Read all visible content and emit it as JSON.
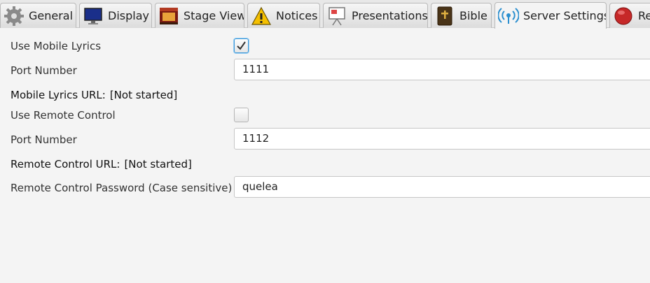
{
  "tabs": [
    {
      "label": "General",
      "icon": "gear-icon"
    },
    {
      "label": "Display",
      "icon": "monitor-icon"
    },
    {
      "label": "Stage View",
      "icon": "stage-icon"
    },
    {
      "label": "Notices",
      "icon": "warning-icon"
    },
    {
      "label": "Presentations",
      "icon": "presentation-icon"
    },
    {
      "label": "Bible",
      "icon": "bible-icon"
    },
    {
      "label": "Server Settings",
      "icon": "broadcast-icon",
      "active": true
    },
    {
      "label": "Re",
      "icon": "record-icon"
    }
  ],
  "settings": {
    "use_mobile_lyrics": {
      "label": "Use Mobile Lyrics",
      "checked": true
    },
    "mobile_port": {
      "label": "Port Number",
      "value": "1111"
    },
    "mobile_url": {
      "label": "Mobile Lyrics URL:",
      "value": "[Not started]"
    },
    "use_remote_control": {
      "label": "Use Remote Control",
      "checked": false
    },
    "remote_port": {
      "label": "Port Number",
      "value": "1112"
    },
    "remote_url": {
      "label": "Remote Control URL:",
      "value": "[Not started]"
    },
    "remote_password": {
      "label": "Remote Control Password (Case sensitive)",
      "value": "quelea"
    }
  },
  "colors": {
    "accent": "#3a96d8",
    "background": "#f4f4f4"
  }
}
